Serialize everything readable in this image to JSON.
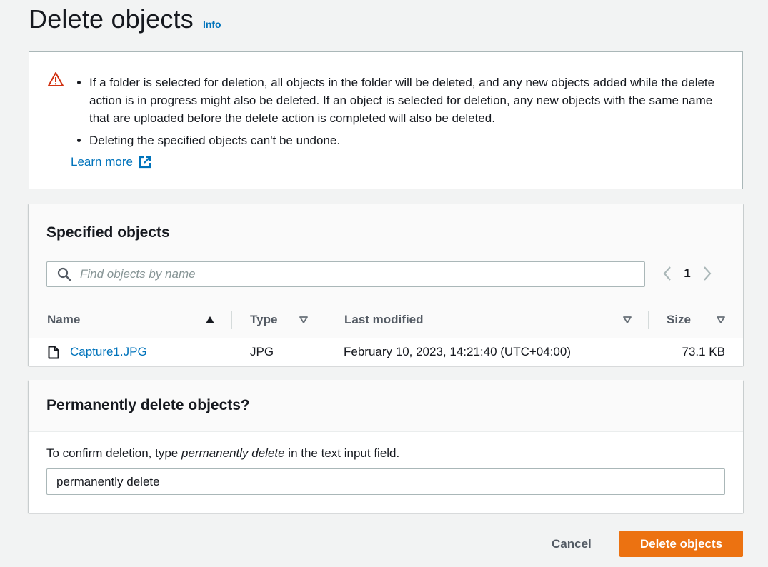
{
  "header": {
    "title": "Delete objects",
    "info_label": "Info"
  },
  "warning": {
    "items": [
      "If a folder is selected for deletion, all objects in the folder will be deleted, and any new objects added while the delete action is in progress might also be deleted. If an object is selected for deletion, any new objects with the same name that are uploaded before the delete action is completed will also be deleted.",
      "Deleting the specified objects can't be undone."
    ],
    "learn_more": "Learn more",
    "icon": "warning-triangle-icon",
    "color": "#d13212"
  },
  "objects": {
    "title": "Specified objects",
    "search": {
      "placeholder": "Find objects by name",
      "value": ""
    },
    "pagination": {
      "current_page": "1"
    },
    "columns": [
      {
        "label": "Name",
        "sort": "ascending"
      },
      {
        "label": "Type",
        "sort": "none"
      },
      {
        "label": "Last modified",
        "sort": "none"
      },
      {
        "label": "Size",
        "sort": "none"
      }
    ],
    "rows": [
      {
        "name": "Capture1.JPG",
        "type": "JPG",
        "last_modified": "February 10, 2023, 14:21:40 (UTC+04:00)",
        "size": "73.1 KB"
      }
    ]
  },
  "confirm": {
    "title": "Permanently delete objects?",
    "desc_prefix": "To confirm deletion, type ",
    "desc_emphasis": "permanently delete",
    "desc_suffix": " in the text input field.",
    "input_value": "permanently delete"
  },
  "actions": {
    "cancel_label": "Cancel",
    "delete_label": "Delete objects"
  },
  "colors": {
    "accent": "#ec7211",
    "link": "#0073bb",
    "background": "#f2f3f3"
  }
}
